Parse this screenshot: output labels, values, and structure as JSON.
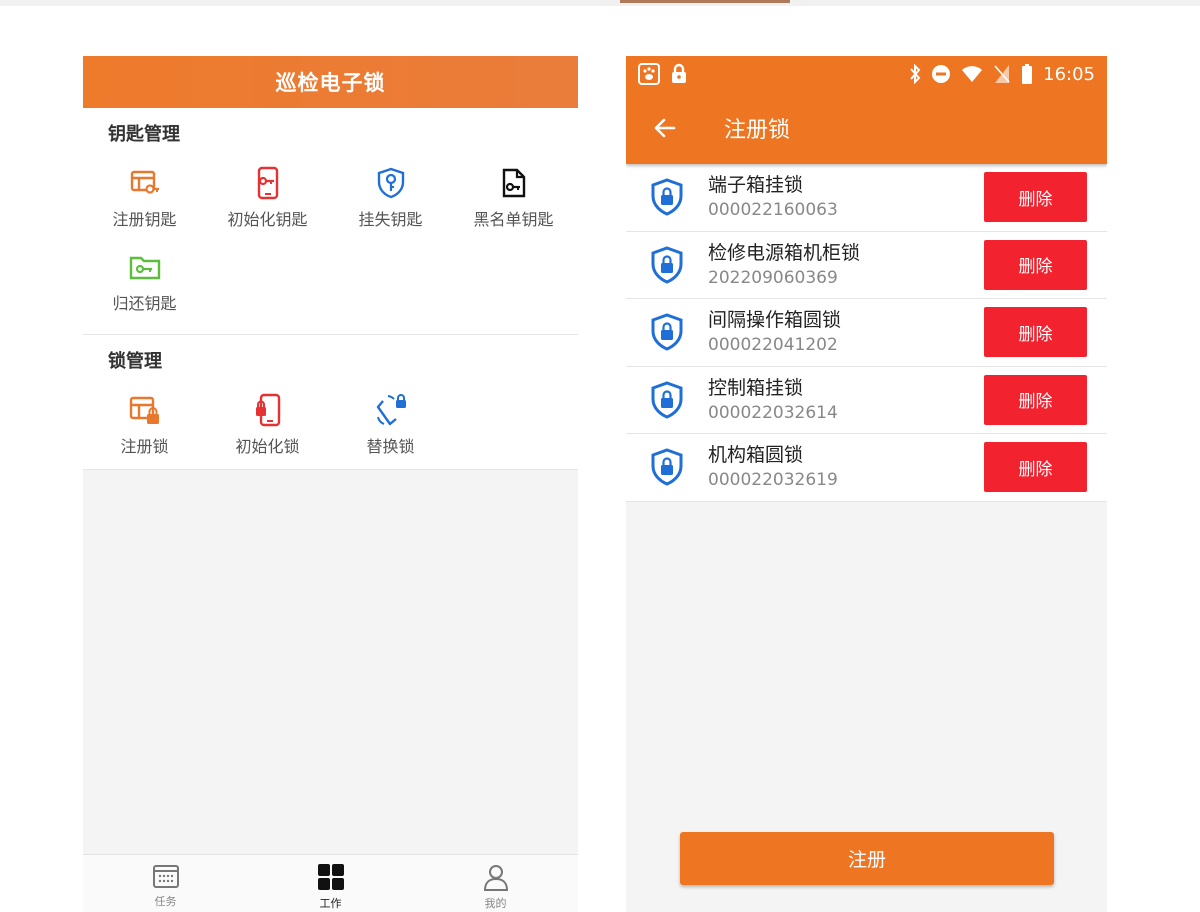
{
  "left": {
    "header_title": "巡检电子锁",
    "key_section": {
      "title": "钥匙管理",
      "items": [
        {
          "label": "注册钥匙",
          "icon": "register-key-icon"
        },
        {
          "label": "初始化钥匙",
          "icon": "init-key-icon"
        },
        {
          "label": "挂失钥匙",
          "icon": "report-lost-key-icon"
        },
        {
          "label": "黑名单钥匙",
          "icon": "blacklist-key-icon"
        },
        {
          "label": "归还钥匙",
          "icon": "return-key-icon"
        }
      ]
    },
    "lock_section": {
      "title": "锁管理",
      "items": [
        {
          "label": "注册锁",
          "icon": "register-lock-icon"
        },
        {
          "label": "初始化锁",
          "icon": "init-lock-icon"
        },
        {
          "label": "替换锁",
          "icon": "replace-lock-icon"
        }
      ]
    },
    "tabbar": [
      {
        "label": "任务",
        "icon": "calendar-icon"
      },
      {
        "label": "工作",
        "icon": "grid-icon",
        "active": true
      },
      {
        "label": "我的",
        "icon": "user-icon"
      }
    ]
  },
  "right": {
    "status_time": "16:05",
    "title": "注册锁",
    "locks": [
      {
        "name": "端子箱挂锁",
        "code": "000022160063",
        "action": "删除"
      },
      {
        "name": "检修电源箱机柜锁",
        "code": "202209060369",
        "action": "删除"
      },
      {
        "name": "间隔操作箱圆锁",
        "code": "000022041202",
        "action": "删除"
      },
      {
        "name": "控制箱挂锁",
        "code": "000022032614",
        "action": "删除"
      },
      {
        "name": "机构箱圆锁",
        "code": "000022032619",
        "action": "删除"
      }
    ],
    "register_button": "注册"
  },
  "colors": {
    "accent_orange": "#ee7623",
    "delete_red": "#f2222f",
    "icon_blue": "#1f6fd6",
    "icon_green": "#5bbf3b"
  }
}
